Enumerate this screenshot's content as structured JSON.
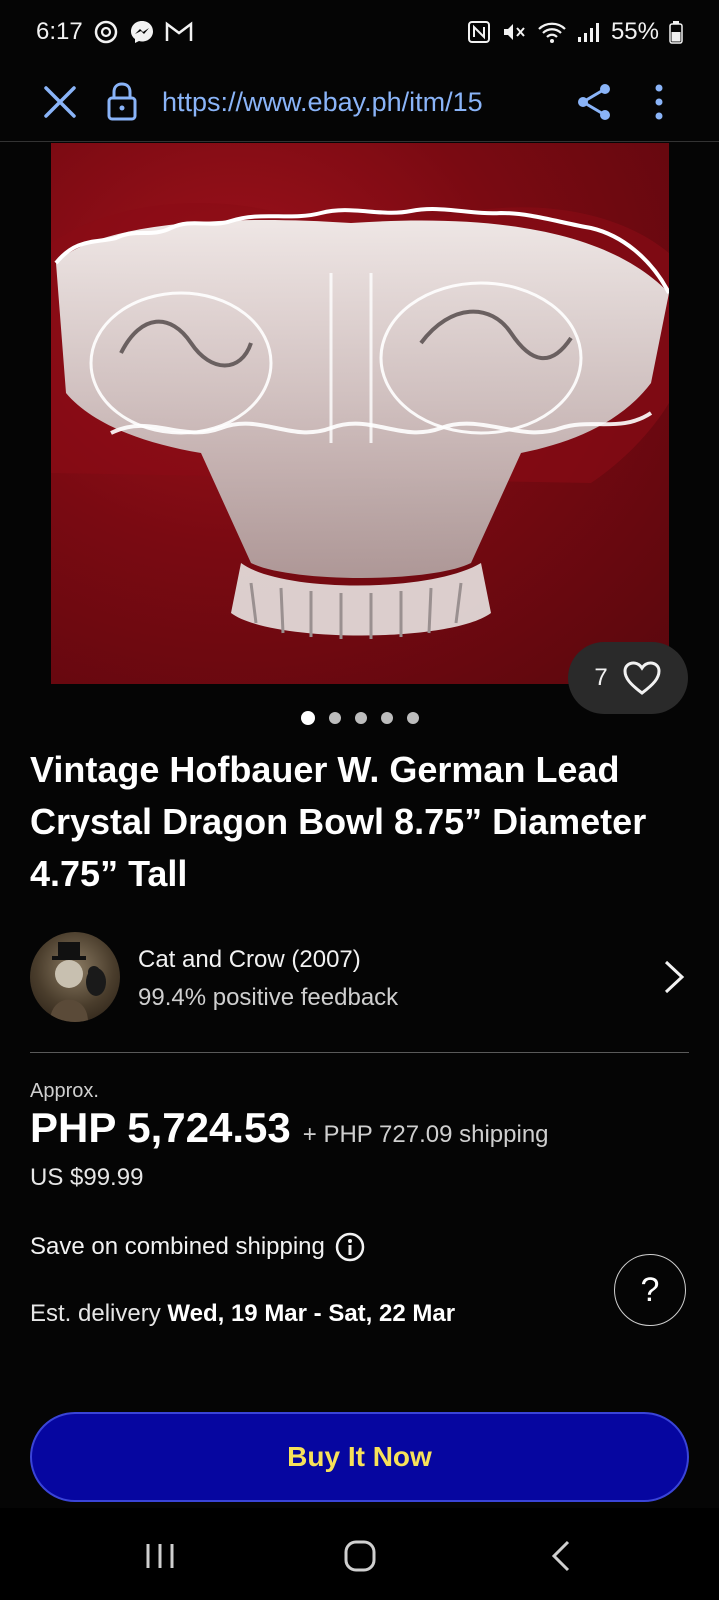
{
  "status_bar": {
    "time": "6:17",
    "battery": "55%",
    "left_icons": [
      "threads-icon",
      "messenger-icon",
      "gmail-icon"
    ],
    "right_icons": [
      "nfc-icon",
      "mute-icon",
      "wifi-icon",
      "signal-icon",
      "battery-icon"
    ]
  },
  "browser": {
    "url": "https://www.ebay.ph/itm/15"
  },
  "gallery": {
    "like_count": "7",
    "total_images": 5,
    "active_index": 0
  },
  "product": {
    "title": "Vintage Hofbauer W. German Lead Crystal Dragon Bowl 8.75” Diameter 4.75” Tall"
  },
  "seller": {
    "name": "Cat and Crow (2007)",
    "feedback": "99.4% positive feedback"
  },
  "pricing": {
    "approx_label": "Approx.",
    "price": "PHP 5,724.53",
    "shipping": "+ PHP 727.09 shipping",
    "usd_price": "US $99.99"
  },
  "shipping_info": {
    "combined_label": "Save on combined shipping",
    "delivery_label": "Est. delivery",
    "delivery_dates": "Wed, 19 Mar - Sat, 22 Mar"
  },
  "help": {
    "label": "?"
  },
  "actions": {
    "buy_now": "Buy It Now"
  },
  "colors": {
    "buy_button_bg": "#0606a0",
    "buy_button_text": "#f7e15a",
    "link_blue": "#8ab4f8"
  }
}
